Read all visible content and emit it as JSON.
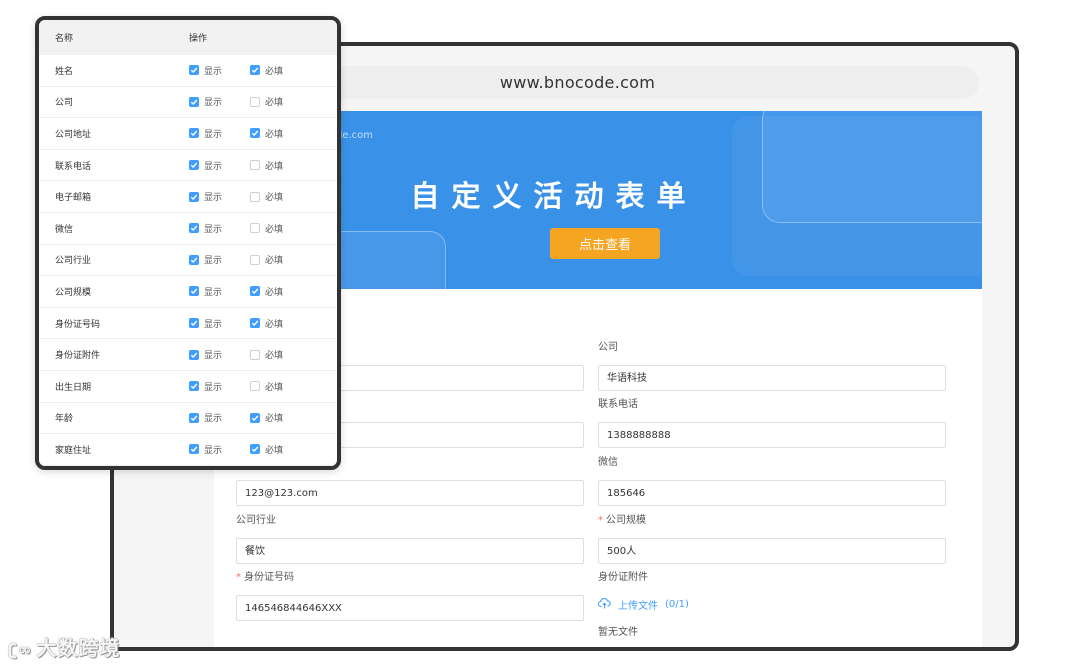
{
  "browser": {
    "url": "www.bnocode.com"
  },
  "banner": {
    "site_text": "de.com",
    "title": "自定义活动表单",
    "cta_label": "点击查看"
  },
  "form": {
    "company_label": "公司",
    "company_value": "华语科技",
    "phone_label": "联系电话",
    "phone_value": "1388888888",
    "email_value": "123@123.com",
    "wechat_label": "微信",
    "wechat_value": "185646",
    "industry_label": "公司行业",
    "industry_value": "餐饮",
    "size_label": "公司规模",
    "size_value": "500人",
    "idcard_label": "身份证号码",
    "idcard_value": "146546844646XXX",
    "idcard_attach_label": "身份证附件",
    "upload_label": "上传文件",
    "upload_count": "(0/1)",
    "no_file": "暂无文件",
    "required_mark": "*"
  },
  "panel": {
    "col_name": "名称",
    "col_action": "操作",
    "show_text": "显示",
    "required_text": "必填",
    "rows": [
      {
        "name": "姓名",
        "show": true,
        "required": true
      },
      {
        "name": "公司",
        "show": true,
        "required": false
      },
      {
        "name": "公司地址",
        "show": true,
        "required": true
      },
      {
        "name": "联系电话",
        "show": true,
        "required": false
      },
      {
        "name": "电子邮箱",
        "show": true,
        "required": false
      },
      {
        "name": "微信",
        "show": true,
        "required": false
      },
      {
        "name": "公司行业",
        "show": true,
        "required": false
      },
      {
        "name": "公司规模",
        "show": true,
        "required": true
      },
      {
        "name": "身份证号码",
        "show": true,
        "required": true
      },
      {
        "name": "身份证附件",
        "show": true,
        "required": false
      },
      {
        "name": "出生日期",
        "show": true,
        "required": false
      },
      {
        "name": "年龄",
        "show": true,
        "required": true
      },
      {
        "name": "家庭住址",
        "show": true,
        "required": true
      }
    ]
  },
  "watermark": {
    "text": "大数跨境"
  },
  "colors": {
    "accent": "#409eff",
    "banner": "#3a91e8",
    "cta": "#f5a522",
    "required": "#f56c6c"
  }
}
